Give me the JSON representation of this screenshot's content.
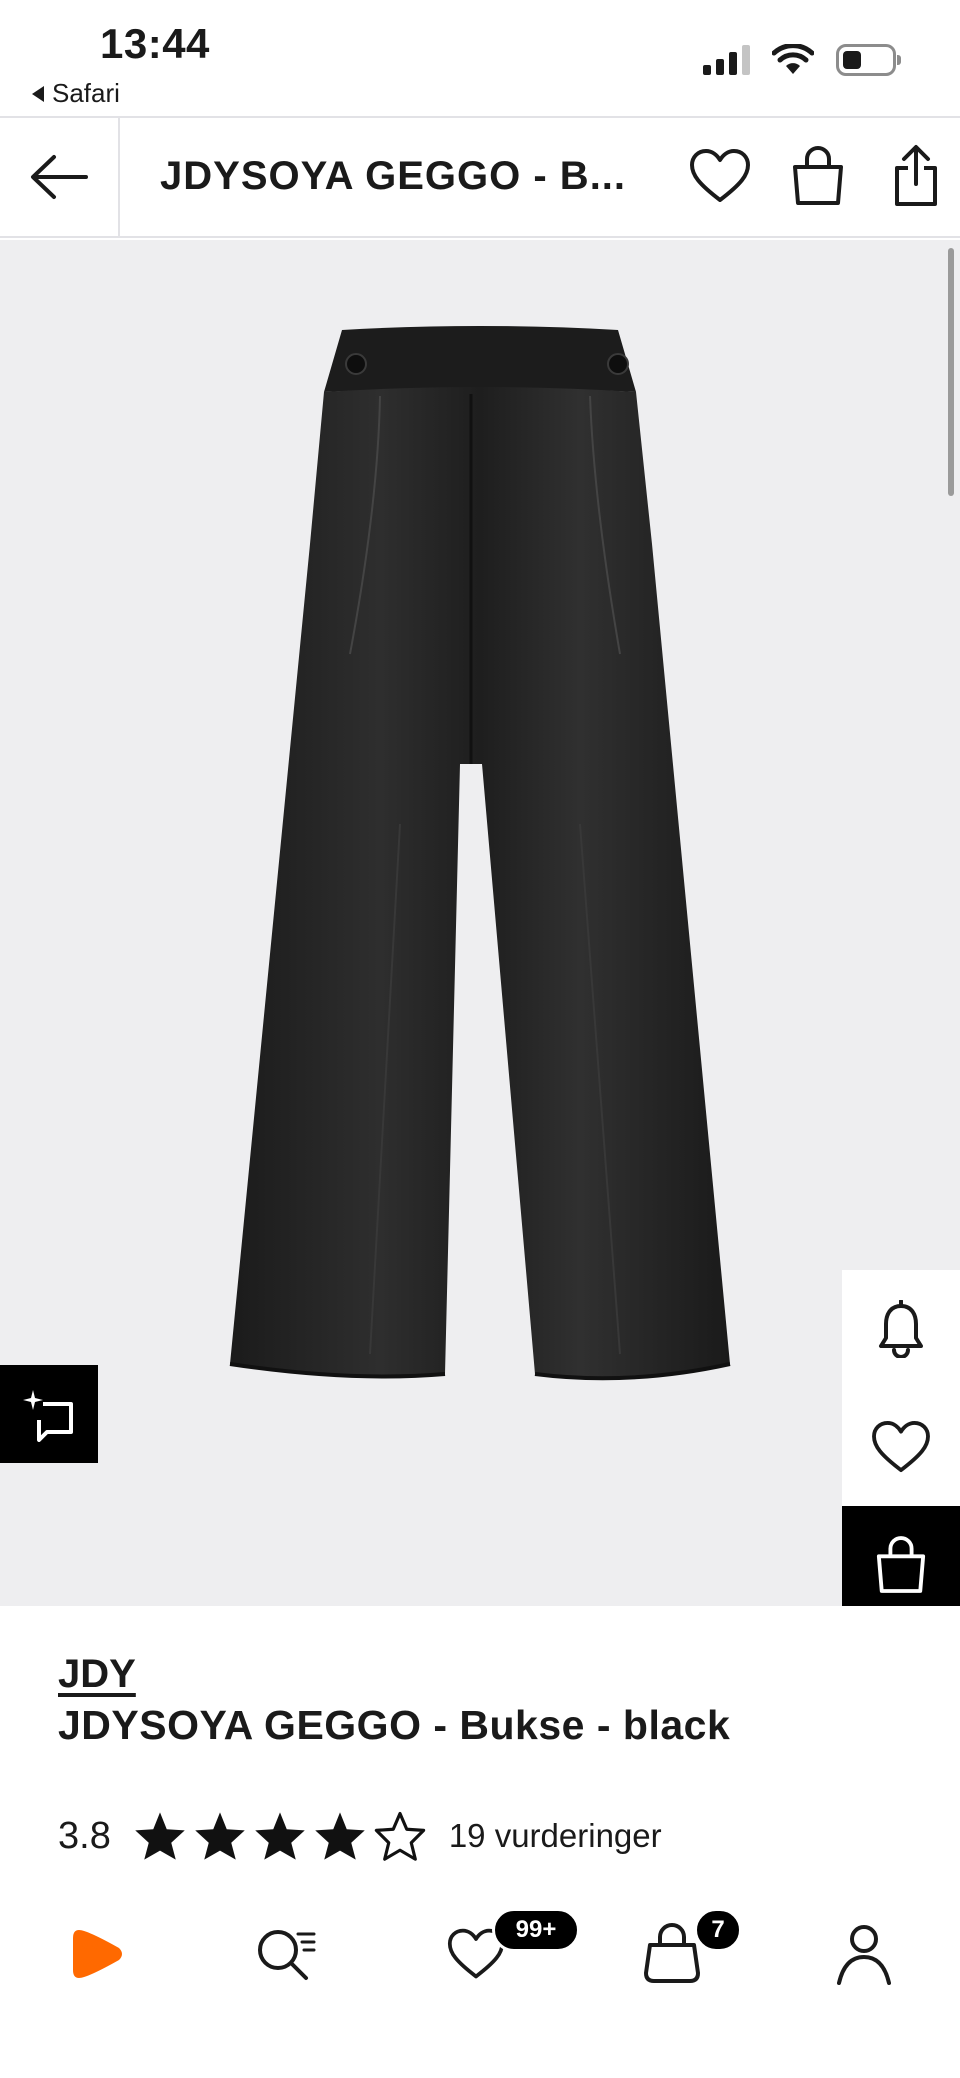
{
  "status_bar": {
    "time": "13:44",
    "back_app": "Safari"
  },
  "header": {
    "title": "JDYSOYA GEGGO - B...",
    "icons": [
      "arrow-left-icon",
      "heart-icon",
      "shopping-bag-icon",
      "share-icon"
    ]
  },
  "gallery": {
    "background_color": "#eeeef0",
    "image_subject": "black wide-leg trousers"
  },
  "side_actions": {
    "icons": [
      "bell-icon",
      "heart-icon",
      "shopping-bag-icon"
    ]
  },
  "product": {
    "brand": "JDY",
    "name": "JDYSOYA GEGGO - Bukse - black",
    "rating": "3.8",
    "rating_stars": 4,
    "rating_max": 5,
    "reviews": "19 vurderinger"
  },
  "bottom_nav": {
    "items": [
      "home-logo",
      "search-icon",
      "wishlist-icon",
      "bag-icon",
      "profile-icon"
    ],
    "wishlist_badge": "99+",
    "bag_badge": "7",
    "brand_color": "#ff6900"
  }
}
